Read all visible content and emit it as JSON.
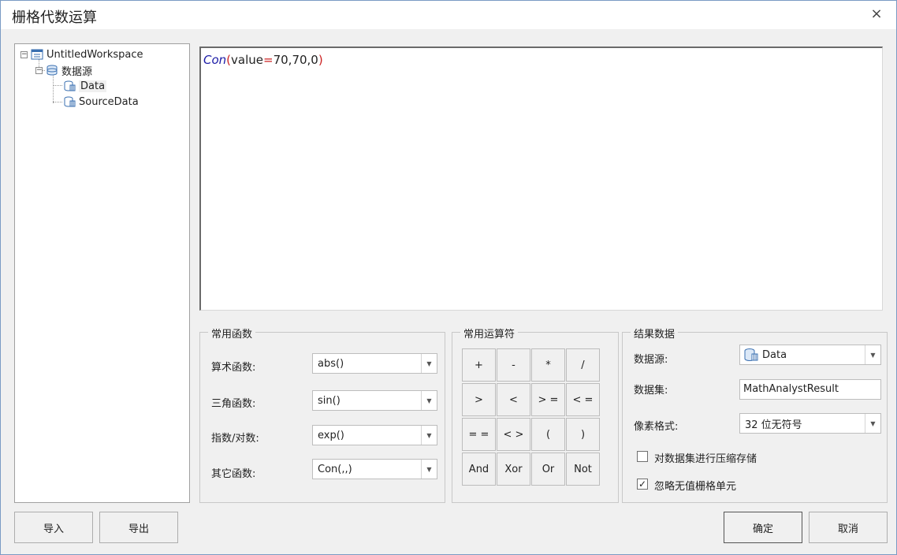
{
  "window": {
    "title": "栅格代数运算"
  },
  "tree": {
    "root": "UntitledWorkspace",
    "datasource": "数据源",
    "items": [
      "Data",
      "SourceData"
    ]
  },
  "expression": {
    "function": "Con",
    "open_paren": "(",
    "arg1": "value",
    "equals": "=",
    "rest": "70,70,0",
    "close_paren": ")"
  },
  "common_functions": {
    "title": "常用函数",
    "rows": [
      {
        "label": "算术函数:",
        "value": "abs()"
      },
      {
        "label": "三角函数:",
        "value": "sin()"
      },
      {
        "label": "指数/对数:",
        "value": "exp()"
      },
      {
        "label": "其它函数:",
        "value": "Con(,,)"
      }
    ]
  },
  "operators": {
    "title": "常用运算符",
    "buttons": [
      "+",
      "-",
      "*",
      "/",
      ">",
      "<",
      "> =",
      "< =",
      "= =",
      "< >",
      "(",
      ")",
      "And",
      "Xor",
      "Or",
      "Not"
    ]
  },
  "result": {
    "title": "结果数据",
    "datasource_label": "数据源:",
    "datasource_value": "Data",
    "dataset_label": "数据集:",
    "dataset_value": "MathAnalystResult",
    "pixel_label": "像素格式:",
    "pixel_value": "32 位无符号",
    "compress_label": "对数据集进行压缩存储",
    "compress_checked": false,
    "ignore_label": "忽略无值栅格单元",
    "ignore_checked": true,
    "check_glyph": "✓"
  },
  "buttons": {
    "import": "导入",
    "export": "导出",
    "ok": "确定",
    "cancel": "取消"
  },
  "icons": {
    "close": "×",
    "dropdown": "▼",
    "collapse": "−"
  }
}
